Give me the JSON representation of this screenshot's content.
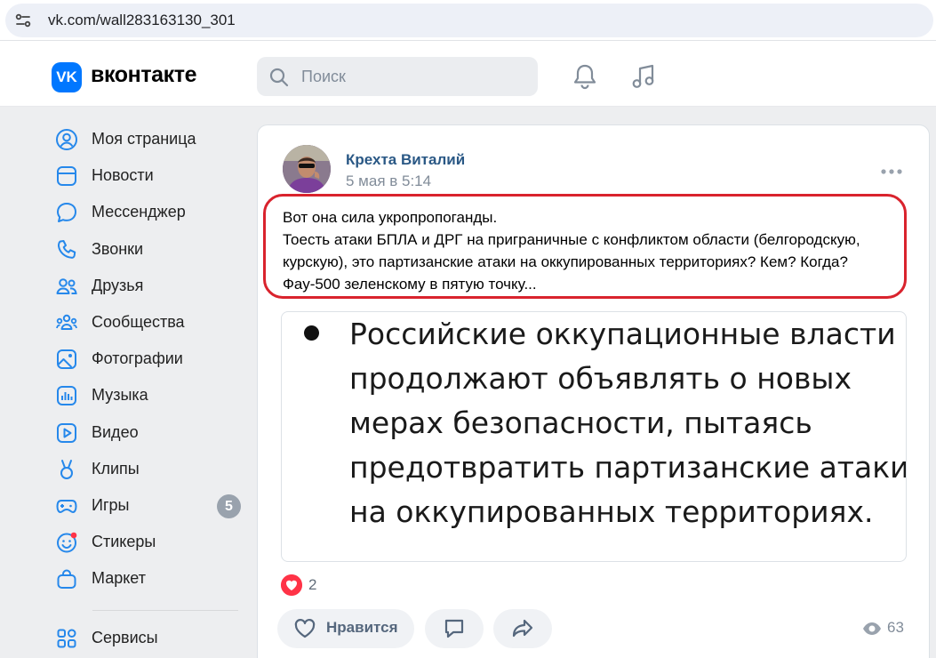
{
  "browser": {
    "url": "vk.com/wall283163130_301",
    "site_info_icon": "site-settings-icon"
  },
  "header": {
    "logo_mark": "VK",
    "logo_text": "вконтакте",
    "search_placeholder": "Поиск",
    "icons": [
      "bell-icon",
      "music-icon"
    ]
  },
  "sidebar": {
    "items": [
      {
        "label": "Моя страница",
        "icon": "profile-icon"
      },
      {
        "label": "Новости",
        "icon": "news-icon"
      },
      {
        "label": "Мессенджер",
        "icon": "messenger-icon"
      },
      {
        "label": "Звонки",
        "icon": "phone-icon"
      },
      {
        "label": "Друзья",
        "icon": "friends-icon"
      },
      {
        "label": "Сообщества",
        "icon": "communities-icon"
      },
      {
        "label": "Фотографии",
        "icon": "photos-icon"
      },
      {
        "label": "Музыка",
        "icon": "music-icon"
      },
      {
        "label": "Видео",
        "icon": "video-icon"
      },
      {
        "label": "Клипы",
        "icon": "clips-icon"
      },
      {
        "label": "Игры",
        "icon": "games-icon",
        "badge": "5"
      },
      {
        "label": "Стикеры",
        "icon": "stickers-icon"
      },
      {
        "label": "Маркет",
        "icon": "market-icon"
      },
      {
        "label": "Сервисы",
        "icon": "services-icon"
      }
    ]
  },
  "post": {
    "author": "Крехта Виталий",
    "date": "5 мая в 5:14",
    "text_lines": [
      "Вот она сила укропропоганды.",
      "Тоесть атаки БПЛА и ДРГ на приграничные с конфликтом области (белгородскую,",
      "курскую), это партизанские атаки на оккупированных территориях? Кем? Когда?",
      "Фау-500 зеленскому в пятую точку..."
    ],
    "image_text_lines": [
      "Российские оккупационные власти",
      "продолжают объявлять о новых",
      "мерах безопасности, пытаясь",
      "предотвратить партизанские атаки",
      "на оккупированных территориях."
    ],
    "reactions_count": "2",
    "like_label": "Нравится",
    "views": "63",
    "highlight_color": "#d9232d",
    "accent_color": "#0077ff"
  }
}
